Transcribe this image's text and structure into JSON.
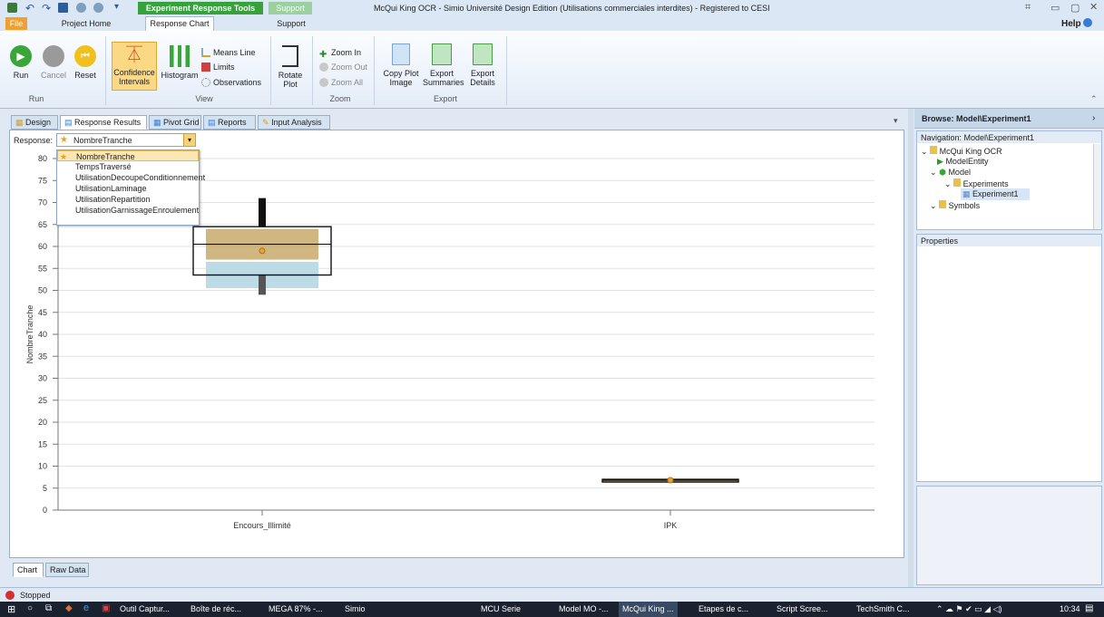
{
  "window": {
    "ctx_tool_tab": "Experiment Response Tools",
    "ctx_support_tab": "Support",
    "title": "McQui King OCR - Simio Université Design Edition (Utilisations commerciales interdites) - Registered to CESI",
    "help": "Help"
  },
  "ribbon_tabs": [
    "File",
    "Project Home",
    "Response Chart",
    "Support"
  ],
  "ribbon": {
    "run": "Run",
    "cancel": "Cancel",
    "reset": "Reset",
    "confidence": "Confidence Intervals",
    "histogram": "Histogram",
    "means_line": "Means Line",
    "limits": "Limits",
    "observations": "Observations",
    "rotate": "Rotate Plot",
    "zoom_in": "Zoom In",
    "zoom_out": "Zoom Out",
    "zoom_all": "Zoom All",
    "copy_plot": "Copy Plot Image",
    "export_summaries": "Export Summaries",
    "export_details": "Export Details",
    "groups": {
      "run": "Run",
      "view": "View",
      "zoom": "Zoom",
      "export": "Export"
    }
  },
  "doc_tabs": [
    "Design",
    "Response Results",
    "Pivot Grid",
    "Reports",
    "Input Analysis"
  ],
  "response": {
    "label": "Response:",
    "selected": "NombreTranche",
    "options": [
      "NombreTranche",
      "TempsTraversé",
      "UtilisationDecoupeConditionnement",
      "UtilisationLaminage",
      "UtilisationRepartition",
      "UtilisationGarnissageEnroulement"
    ]
  },
  "bottom_tabs": [
    "Chart",
    "Raw Data"
  ],
  "chart_data": {
    "type": "box",
    "ylabel": "NombreTranche",
    "ylim": [
      0,
      80
    ],
    "yticks": [
      0,
      5,
      10,
      15,
      20,
      25,
      30,
      35,
      40,
      45,
      50,
      55,
      60,
      65,
      70,
      75,
      80
    ],
    "categories": [
      "Encours_Illimité",
      "IPK"
    ],
    "boxes": [
      {
        "category": "Encours_Illimité",
        "min": 49,
        "q1": 53.5,
        "median": 60.5,
        "q3": 64.5,
        "max": 71,
        "mean": 59,
        "ci_upper": [
          57,
          64
        ],
        "ci_lower": [
          50.5,
          56.5
        ]
      },
      {
        "category": "IPK",
        "min": 6.8,
        "q1": 6.5,
        "median": 6.8,
        "q3": 7.0,
        "max": 7.0,
        "mean": 6.8
      }
    ],
    "grid": true
  },
  "browse": {
    "title": "Browse: Model\\Experiment1",
    "navigation": "Navigation: Model\\Experiment1",
    "tree": [
      {
        "label": "McQui King OCR",
        "level": 0
      },
      {
        "label": "ModelEntity",
        "level": 1
      },
      {
        "label": "Model",
        "level": 1
      },
      {
        "label": "Experiments",
        "level": 2
      },
      {
        "label": "Experiment1",
        "level": 3
      },
      {
        "label": "Symbols",
        "level": 1
      }
    ],
    "properties": "Properties"
  },
  "status": "Stopped",
  "taskbar": {
    "items": [
      "Outil Captur...",
      "Boîte de réc...",
      "MEGA 87% -...",
      "Simio",
      "MCU Serie",
      "Model MO -...",
      "McQui King ...",
      "Etapes de c...",
      "Script Scree...",
      "TechSmith C..."
    ],
    "time": "10:34"
  },
  "colors": {
    "ci_upper": "#c8a96a",
    "ci_lower": "#bcdbe6",
    "mean": "#e8a23a",
    "whisker": "#111111"
  }
}
